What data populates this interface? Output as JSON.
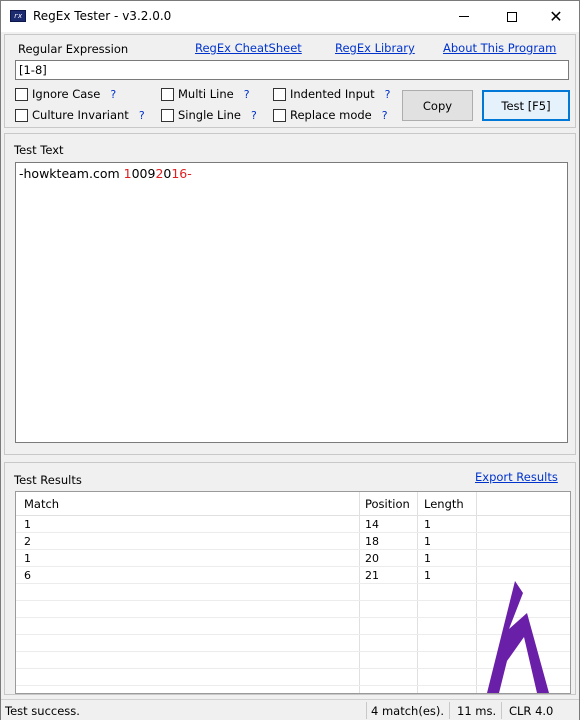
{
  "window": {
    "title": "RegEx Tester - v3.2.0.0",
    "icon_label": "rx"
  },
  "regex": {
    "label": "Regular Expression",
    "value": "[1-8]",
    "links": {
      "cheatsheet": "RegEx CheatSheet",
      "library": "RegEx Library",
      "about": "About This Program"
    }
  },
  "options": {
    "ignore_case": "Ignore Case",
    "culture_invariant": "Culture Invariant",
    "multi_line": "Multi Line",
    "single_line": "Single Line",
    "indented_input": "Indented Input",
    "replace_mode": "Replace mode",
    "help": "?"
  },
  "buttons": {
    "copy": "Copy",
    "test": "Test [F5]"
  },
  "test_text": {
    "label": "Test Text",
    "prefix": "-howkteam.com ",
    "segments": [
      {
        "t": "1",
        "m": true
      },
      {
        "t": "00",
        "m": false
      },
      {
        "t": "9",
        "m": false
      },
      {
        "t": "2",
        "m": true
      },
      {
        "t": "0",
        "m": false
      },
      {
        "t": "1",
        "m": true
      },
      {
        "t": "6",
        "m": true
      }
    ],
    "suffix": "-",
    "highlight_color": "#e02020"
  },
  "results": {
    "label": "Test Results",
    "export_link": "Export Results",
    "columns": [
      "Match",
      "Position",
      "Length"
    ],
    "rows": [
      {
        "match": "1",
        "position": "14",
        "length": "1"
      },
      {
        "match": "2",
        "position": "18",
        "length": "1"
      },
      {
        "match": "1",
        "position": "20",
        "length": "1"
      },
      {
        "match": "6",
        "position": "21",
        "length": "1"
      }
    ]
  },
  "status": {
    "message": "Test success.",
    "matches": "4 match(es).",
    "time": "11 ms.",
    "clr": "CLR 4.0"
  },
  "colors": {
    "link": "#0033cc",
    "logo": "#6a1fa8",
    "focus_border": "#0078d7"
  }
}
